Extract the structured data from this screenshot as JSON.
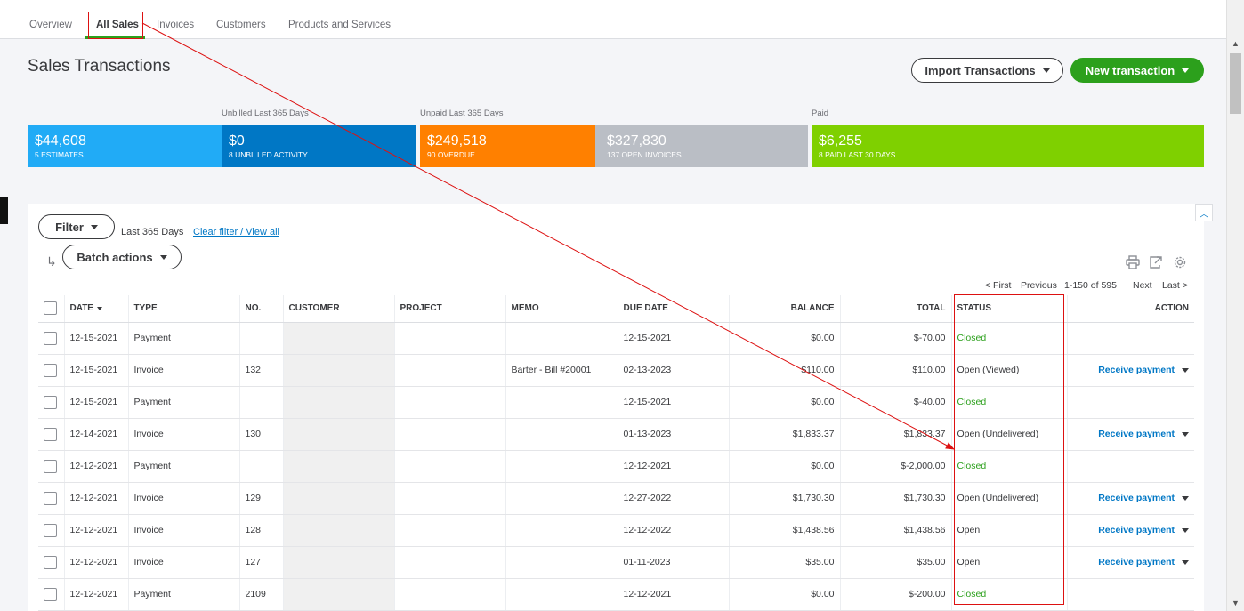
{
  "tabs": [
    {
      "label": "Overview"
    },
    {
      "label": "All Sales"
    },
    {
      "label": "Invoices"
    },
    {
      "label": "Customers"
    },
    {
      "label": "Products and Services"
    }
  ],
  "header": {
    "title": "Sales Transactions",
    "import_label": "Import Transactions",
    "new_label": "New transaction"
  },
  "money_bar": {
    "unbilled_label": "Unbilled Last 365 Days",
    "unpaid_label": "Unpaid Last 365 Days",
    "paid_label": "Paid",
    "segments": [
      {
        "amount": "$44,608",
        "sub": "5 ESTIMATES",
        "color": "#21abf6"
      },
      {
        "amount": "$0",
        "sub": "8 UNBILLED ACTIVITY",
        "color": "#0077c5"
      },
      {
        "amount": "$249,518",
        "sub": "90 OVERDUE",
        "color": "#ff8000"
      },
      {
        "amount": "$327,830",
        "sub": "137 OPEN INVOICES",
        "color": "#babec5"
      },
      {
        "amount": "$6,255",
        "sub": "8 PAID LAST 30 DAYS",
        "color": "#7fd000"
      }
    ]
  },
  "filter": {
    "filter_label": "Filter",
    "range": "Last 365 Days",
    "clear": "Clear filter / View all",
    "batch_label": "Batch actions"
  },
  "pager": {
    "first": "< First",
    "previous": "Previous",
    "range": "1-150 of 595",
    "next": "Next",
    "last": "Last >"
  },
  "table": {
    "headers": {
      "date": "DATE",
      "type": "TYPE",
      "no": "NO.",
      "customer": "CUSTOMER",
      "project": "PROJECT",
      "memo": "MEMO",
      "due": "DUE DATE",
      "balance": "BALANCE",
      "total": "TOTAL",
      "status": "STATUS",
      "action": "ACTION"
    },
    "rows": [
      {
        "date": "12-15-2021",
        "type": "Payment",
        "no": "",
        "memo": "",
        "due": "12-15-2021",
        "balance": "$0.00",
        "total": "$-70.00",
        "status": "Closed",
        "action": ""
      },
      {
        "date": "12-15-2021",
        "type": "Invoice",
        "no": "132",
        "memo": "Barter - Bill #20001",
        "due": "02-13-2023",
        "balance": "$110.00",
        "total": "$110.00",
        "status": "Open (Viewed)",
        "action": "Receive payment"
      },
      {
        "date": "12-15-2021",
        "type": "Payment",
        "no": "",
        "memo": "",
        "due": "12-15-2021",
        "balance": "$0.00",
        "total": "$-40.00",
        "status": "Closed",
        "action": ""
      },
      {
        "date": "12-14-2021",
        "type": "Invoice",
        "no": "130",
        "memo": "",
        "due": "01-13-2023",
        "balance": "$1,833.37",
        "total": "$1,833.37",
        "status": "Open (Undelivered)",
        "action": "Receive payment"
      },
      {
        "date": "12-12-2021",
        "type": "Payment",
        "no": "",
        "memo": "",
        "due": "12-12-2021",
        "balance": "$0.00",
        "total": "$-2,000.00",
        "status": "Closed",
        "action": ""
      },
      {
        "date": "12-12-2021",
        "type": "Invoice",
        "no": "129",
        "memo": "",
        "due": "12-27-2022",
        "balance": "$1,730.30",
        "total": "$1,730.30",
        "status": "Open (Undelivered)",
        "action": "Receive payment"
      },
      {
        "date": "12-12-2021",
        "type": "Invoice",
        "no": "128",
        "memo": "",
        "due": "12-12-2022",
        "balance": "$1,438.56",
        "total": "$1,438.56",
        "status": "Open",
        "action": "Receive payment"
      },
      {
        "date": "12-12-2021",
        "type": "Invoice",
        "no": "127",
        "memo": "",
        "due": "01-11-2023",
        "balance": "$35.00",
        "total": "$35.00",
        "status": "Open",
        "action": "Receive payment"
      },
      {
        "date": "12-12-2021",
        "type": "Payment",
        "no": "2109",
        "memo": "",
        "due": "12-12-2021",
        "balance": "$0.00",
        "total": "$-200.00",
        "status": "Closed",
        "action": ""
      }
    ]
  },
  "colors": {
    "accent": "#2ca01c",
    "link": "#0077c5",
    "annotation": "#dd1111"
  }
}
